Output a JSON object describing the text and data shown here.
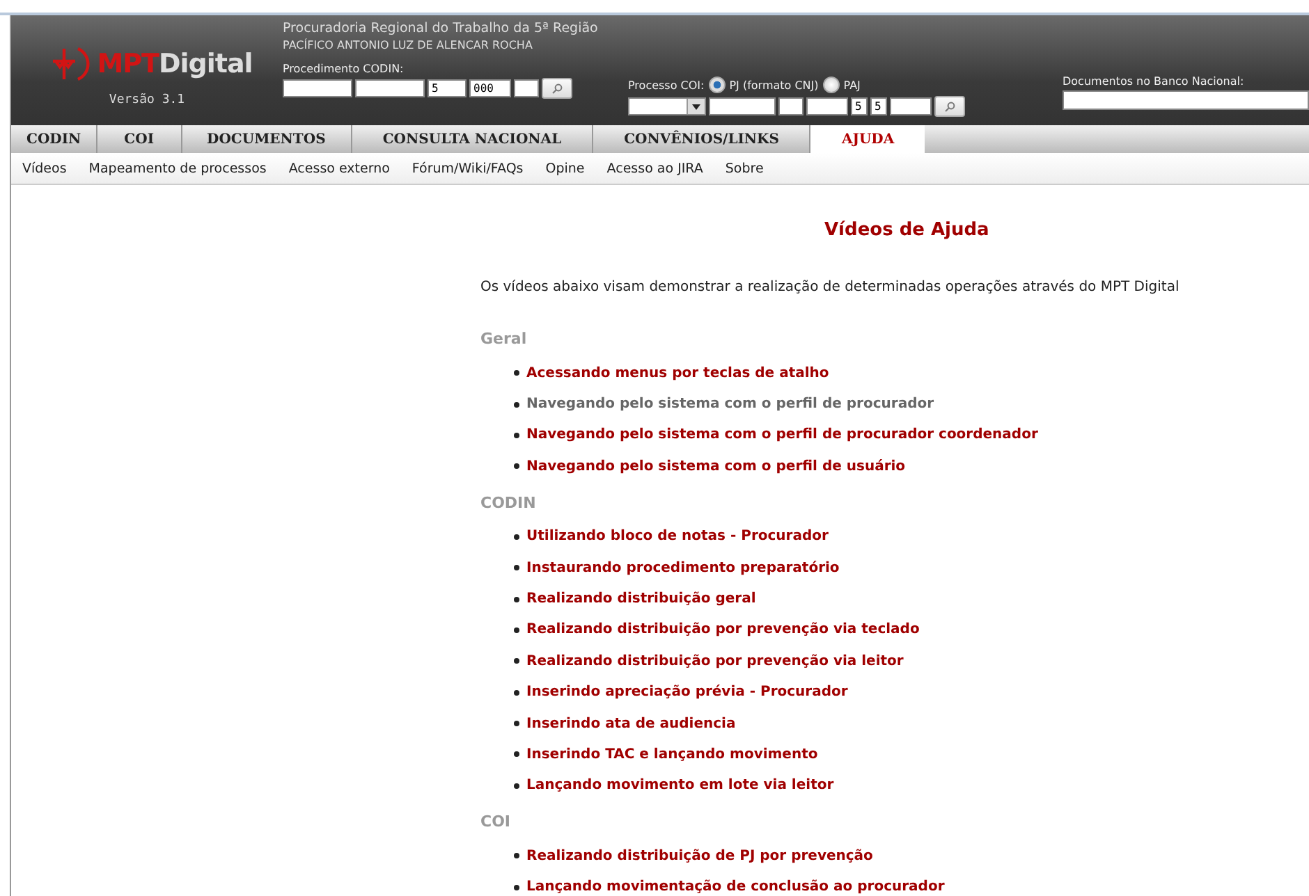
{
  "header": {
    "logo": {
      "brand_bold": "MPT",
      "brand_rest": "Digital",
      "version": "Versão 3.1"
    },
    "office": "Procuradoria Regional do Trabalho da 5ª Região",
    "user": "PACÍFICO ANTONIO LUZ DE ALENCAR ROCHA",
    "codin": {
      "label": "Procedimento CODIN:",
      "fields": [
        {
          "kind": "input"
        },
        {
          "kind": "input"
        },
        {
          "kind": "input",
          "value": "5"
        },
        {
          "kind": "input",
          "value": "000"
        },
        {
          "kind": "input"
        }
      ]
    },
    "coi": {
      "label": "Processo COI:",
      "options": [
        {
          "label": "PJ (formato CNJ)",
          "selected": true
        },
        {
          "label": "PAJ",
          "selected": false
        }
      ],
      "fields": [
        {
          "kind": "select"
        },
        {
          "kind": "input"
        },
        {
          "kind": "input"
        },
        {
          "kind": "input"
        },
        {
          "kind": "input",
          "value": "5"
        },
        {
          "kind": "input",
          "value": "5"
        },
        {
          "kind": "input"
        }
      ]
    },
    "national": {
      "label": "Documentos no Banco Nacional:"
    }
  },
  "tabs": [
    {
      "label": "CODIN",
      "selected": false
    },
    {
      "label": "COI",
      "selected": false
    },
    {
      "label": "DOCUMENTOS",
      "selected": false
    },
    {
      "label": "CONSULTA NACIONAL",
      "selected": false
    },
    {
      "label": "CONVÊNIOS/LINKS",
      "selected": false
    },
    {
      "label": "AJUDA",
      "selected": true
    }
  ],
  "submenu": [
    "Vídeos",
    "Mapeamento de processos",
    "Acesso externo",
    "Fórum/Wiki/FAQs",
    "Opine",
    "Acesso ao JIRA",
    "Sobre"
  ],
  "content": {
    "title": "Vídeos de Ajuda",
    "intro": "Os vídeos abaixo visam demonstrar a realização de determinadas operações através do MPT Digital",
    "sections": [
      {
        "title": "Geral",
        "videos": [
          {
            "label": "Acessando menus por teclas de atalho",
            "visited": false
          },
          {
            "label": "Navegando pelo sistema com o perfil de procurador",
            "visited": true
          },
          {
            "label": "Navegando pelo sistema com o perfil de procurador coordenador",
            "visited": false
          },
          {
            "label": "Navegando pelo sistema com o perfil de usuário",
            "visited": false
          }
        ]
      },
      {
        "title": "CODIN",
        "videos": [
          {
            "label": "Utilizando bloco de notas - Procurador",
            "visited": false
          },
          {
            "label": "Instaurando procedimento preparatório",
            "visited": false
          },
          {
            "label": "Realizando distribuição geral",
            "visited": false
          },
          {
            "label": "Realizando distribuição por prevenção via teclado",
            "visited": false
          },
          {
            "label": "Realizando distribuição por prevenção via leitor",
            "visited": false
          },
          {
            "label": "Inserindo apreciação prévia - Procurador",
            "visited": false
          },
          {
            "label": "Inserindo ata de audiencia",
            "visited": false
          },
          {
            "label": "Inserindo TAC e lançando movimento",
            "visited": false
          },
          {
            "label": "Lançando movimento em lote via leitor",
            "visited": false
          }
        ]
      },
      {
        "title": "COI",
        "videos": [
          {
            "label": "Realizando distribuição de PJ por prevenção",
            "visited": false
          },
          {
            "label": "Lançando movimentação de conclusão ao procurador",
            "visited": false
          }
        ]
      }
    ]
  }
}
